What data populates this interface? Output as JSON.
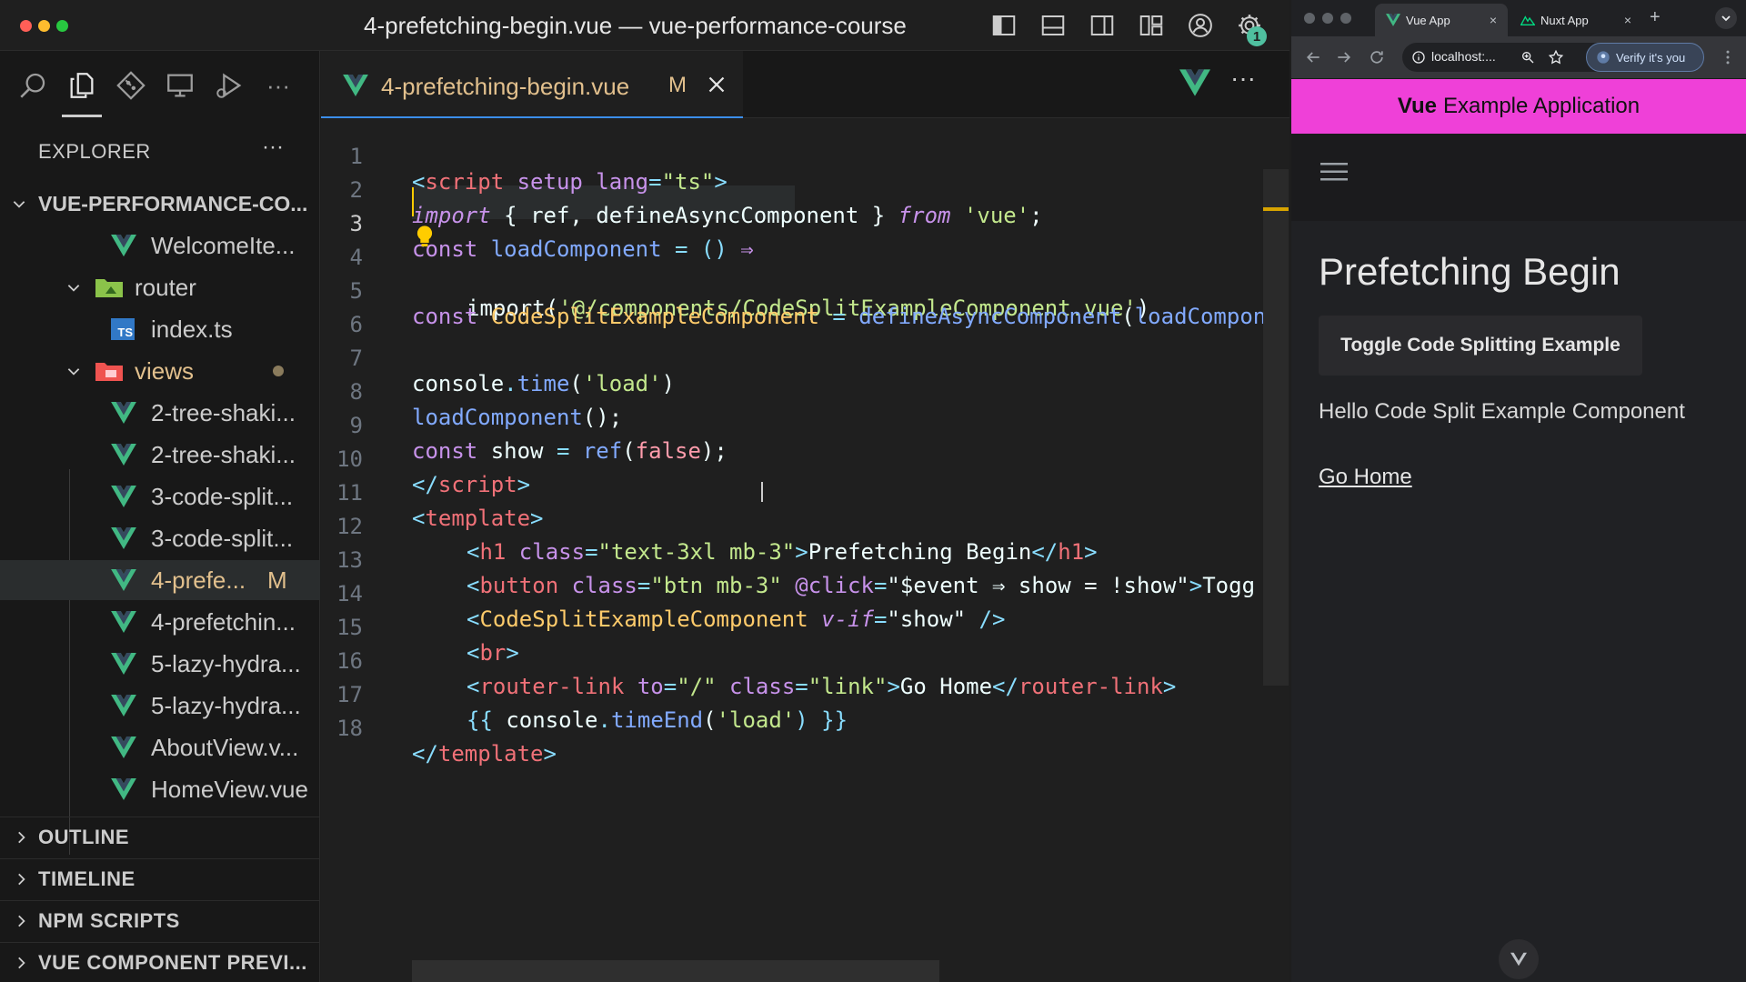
{
  "vscode": {
    "window_title": "4-prefetching-begin.vue — vue-performance-course",
    "settings_badge": "1",
    "explorer": {
      "title": "EXPLORER",
      "more": "···",
      "project": "VUE-PERFORMANCE-CO...",
      "items": [
        {
          "label": "WelcomeIte...",
          "type": "vue"
        },
        {
          "label": "router",
          "type": "folder"
        },
        {
          "label": "index.ts",
          "type": "ts"
        },
        {
          "label": "views",
          "type": "folder"
        },
        {
          "label": "2-tree-shaki...",
          "type": "vue"
        },
        {
          "label": "2-tree-shaki...",
          "type": "vue"
        },
        {
          "label": "3-code-split...",
          "type": "vue"
        },
        {
          "label": "3-code-split...",
          "type": "vue"
        },
        {
          "label": "4-prefe...",
          "type": "vue",
          "badge": "M"
        },
        {
          "label": "4-prefetchin...",
          "type": "vue"
        },
        {
          "label": "5-lazy-hydra...",
          "type": "vue"
        },
        {
          "label": "5-lazy-hydra...",
          "type": "vue"
        },
        {
          "label": "AboutView.v...",
          "type": "vue"
        },
        {
          "label": "HomeView.vue",
          "type": "vue"
        }
      ],
      "ts_badge": "TS",
      "sections": [
        "OUTLINE",
        "TIMELINE",
        "NPM SCRIPTS",
        "VUE COMPONENT PREVI..."
      ]
    },
    "tab": {
      "label": "4-prefetching-begin.vue",
      "modified": "M"
    },
    "editor_more": "···",
    "line_numbers": [
      "1",
      "2",
      "3",
      "4",
      "5",
      "6",
      "7",
      "8",
      "9",
      "10",
      "11",
      "12",
      "13",
      "14",
      "15",
      "16",
      "17",
      "18"
    ],
    "code": {
      "l1": [
        "<",
        "script",
        " setup",
        " lang",
        "=",
        "\"ts\"",
        ">"
      ],
      "l2": [
        "import",
        " { ",
        "ref",
        ", ",
        "defineAsyncComponent",
        " } ",
        "from",
        " ",
        "'vue'",
        ";"
      ],
      "l3": [
        "const",
        " ",
        "loadComponent",
        " ",
        "=",
        " ",
        "()",
        " ",
        "⇒"
      ],
      "l4": [
        "import",
        "(",
        "'@/components/CodeSplitExampleComponent.vue'",
        ")"
      ],
      "l5": [
        "const",
        " ",
        "CodeSplitExampleComponent",
        " = ",
        "defineAsyncComponent",
        "(",
        "loadCompon"
      ],
      "l7": [
        "console",
        ".",
        "time",
        "(",
        "'load'",
        ")"
      ],
      "l8": [
        "loadComponent",
        "();"
      ],
      "l9": [
        "const",
        " ",
        "show",
        " = ",
        "ref",
        "(",
        "false",
        ");"
      ],
      "l10": [
        "</",
        "script",
        ">"
      ],
      "l11": [
        "<",
        "template",
        ">"
      ],
      "l12": [
        "<",
        "h1",
        " class",
        "=",
        "\"text-3xl mb-3\"",
        ">",
        "Prefetching Begin",
        "</",
        "h1",
        ">"
      ],
      "l13": [
        "<",
        "button",
        " class",
        "=",
        "\"btn mb-3\"",
        " @click",
        "=",
        "\"$event ⇒ show = !show\"",
        ">",
        "Togg"
      ],
      "l14": [
        "<",
        "CodeSplitExampleComponent",
        " v-if",
        "=",
        "\"show\"",
        " />"
      ],
      "l15": [
        "<",
        "br",
        ">"
      ],
      "l16": [
        "<",
        "router-link",
        " to",
        "=",
        "\"/\"",
        " class",
        "=",
        "\"link\"",
        ">",
        "Go Home",
        "</",
        "router-link",
        ">"
      ],
      "l17": [
        "{{ ",
        "console",
        ".",
        "timeEnd",
        "(",
        "'load'",
        ") }}"
      ],
      "l18": [
        "</",
        "template",
        ">"
      ]
    }
  },
  "browser": {
    "tabs": [
      {
        "label": "Vue App",
        "close": "×"
      },
      {
        "label": "Nuxt App",
        "close": "×"
      }
    ],
    "new_tab": "+",
    "url": "localhost:...",
    "verify_label": "Verify it's you",
    "app": {
      "brand": "Vue",
      "header_rest": "Example Application",
      "heading": "Prefetching Begin",
      "toggle_label": "Toggle Code Splitting Example",
      "hello": "Hello Code Split Example Component",
      "go_home": "Go Home"
    }
  },
  "colors": {
    "vue_green": "#41b883",
    "vue_dark": "#35495e",
    "app_header": "#ef40d8",
    "modified": "#e2c08d"
  }
}
